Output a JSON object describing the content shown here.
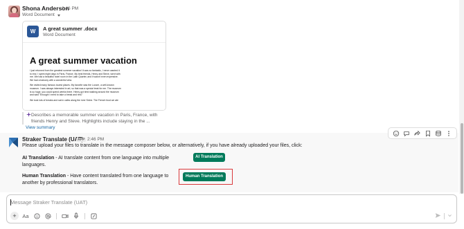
{
  "colors": {
    "link": "#1264a3",
    "button_green": "#007a5a",
    "highlight_red": "#d9383a",
    "ai_sparkle": "#6a3ea1"
  },
  "message1": {
    "sender": "Shona Anderson",
    "time": "2:46 PM",
    "file_type": "Word Document",
    "file": {
      "icon_letter": "W",
      "name": "A great summer .docx",
      "subtitle": "Word Document",
      "preview_title": "A great summer vacation",
      "preview_lines": [
        "I just returned from the greatest summer vacation! It was so fantastic, I never wanted it",
        "to end. I spent eight days in Paris, France. My best friends, Henry and Steve, went with",
        "me. We had a beautiful hotel room in the Latin Quarter, and it wasn't even expensive.",
        "We had a balcony with a wonderful view.",
        "",
        "We visited many famous tourist places. My favorite was the Louvre, a well-known",
        "museum. I was always interested in art, so that was a special treat for me. The museum",
        "is so huge, you could spend weeks there. Henry got tired walking around the museum",
        "and said \"Enough! I need to take a break and rest.\"",
        "We took lots of breaks and sat in cafes along the river Seine. The French food we ate"
      ]
    },
    "summary": "Describes a memorable summer vacation in Paris, France, with friends Henry and Steve. Highlights include staying in the ...",
    "summary_line1": "Describes a memorable summer vacation in Paris, France, with",
    "summary_line2": "friends Henry and Steve. Highlights include staying in the ...",
    "view_summary": "View summary"
  },
  "message2": {
    "sender": "Straker Translate (UAT)",
    "badge": "APP",
    "time": "2:46 PM",
    "text": "Please upload your files to translate in the message composer below, or alternatively, if you have already uploaded your files, click:",
    "ai": {
      "title": "AI Translation",
      "description": " - AI translate content from one language into multiple languages.",
      "button": "AI Translation"
    },
    "human": {
      "title": "Human Translation",
      "description": " - Have content translated from one language to another by professional translators.",
      "button": "Human Translation"
    },
    "toolbar_icons": [
      "add-reaction-icon",
      "reply-icon",
      "share-icon",
      "bookmark-icon",
      "apps-icon",
      "more-icon"
    ]
  },
  "composer": {
    "placeholder": "Message Straker Translate (UAT)",
    "tools": [
      "plus-icon",
      "format-icon",
      "emoji-icon",
      "mention-icon",
      "video-icon",
      "microphone-icon",
      "shortcuts-icon"
    ]
  }
}
